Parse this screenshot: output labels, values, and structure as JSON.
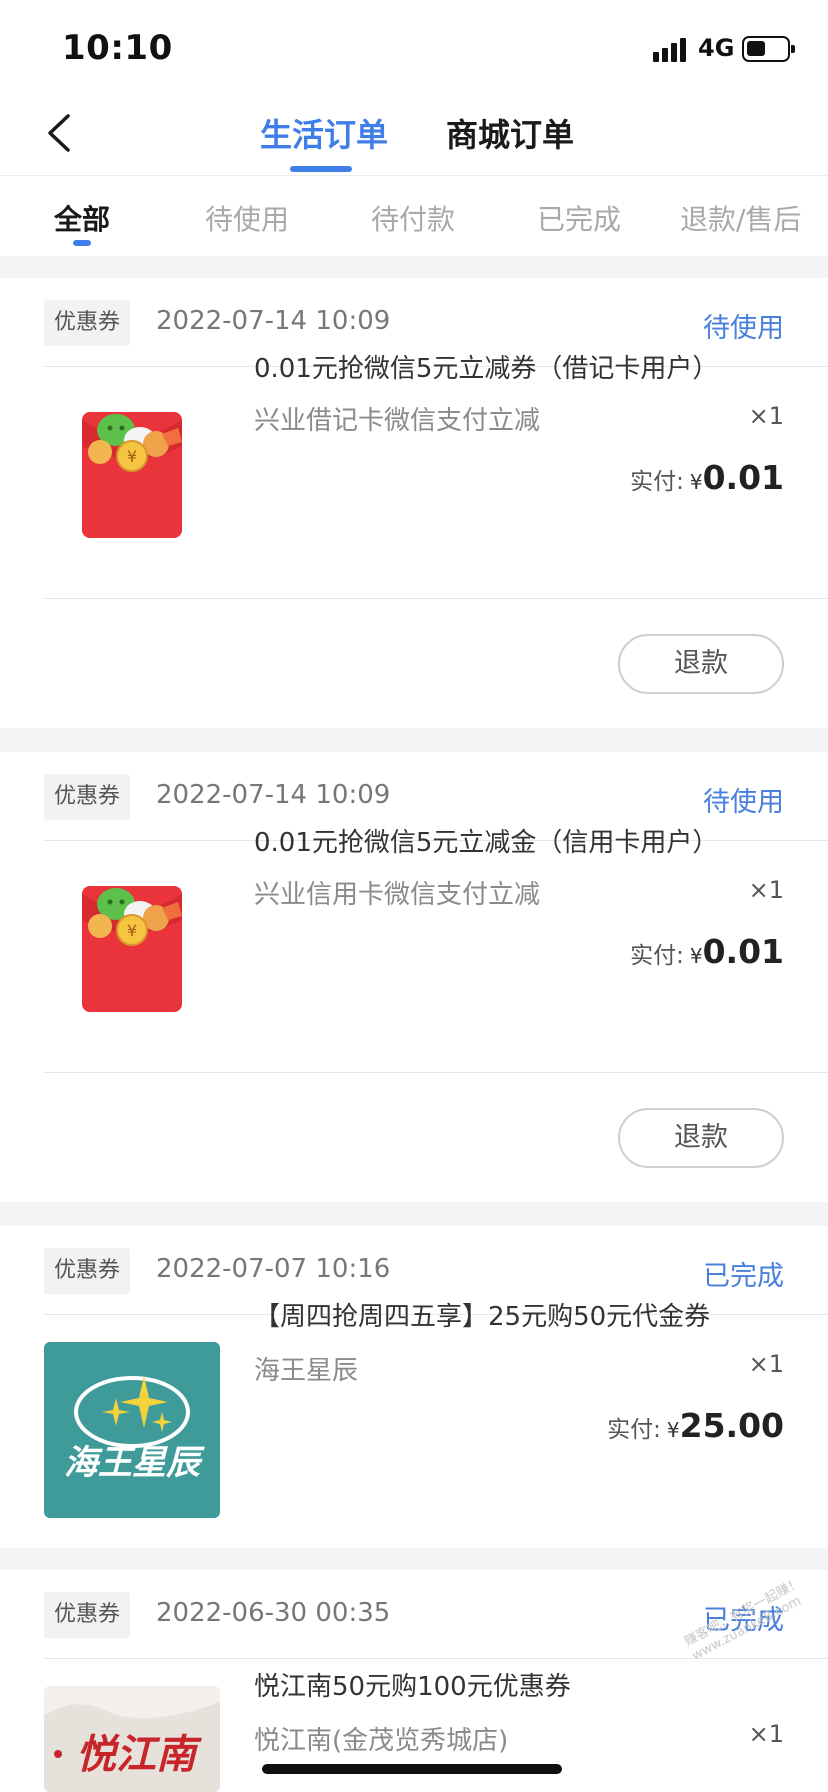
{
  "status_bar": {
    "time": "10:10",
    "network": "4G"
  },
  "header": {
    "tabs": [
      "生活订单",
      "商城订单"
    ],
    "active_tab": "生活订单"
  },
  "sub_tabs": [
    "全部",
    "待使用",
    "待付款",
    "已完成",
    "退款/售后"
  ],
  "orders": [
    {
      "tag": "优惠券",
      "time": "2022-07-14 10:09",
      "status": "待使用",
      "title": "0.01元抢微信5元立减券（借记卡用户）",
      "subtitle": "兴业借记卡微信支付立减",
      "qty": "×1",
      "paid_label": "实付:",
      "currency": "¥",
      "amount": "0.01",
      "action": "退款",
      "thumb": "wechat-red-envelope-icon"
    },
    {
      "tag": "优惠券",
      "time": "2022-07-14 10:09",
      "status": "待使用",
      "title": "0.01元抢微信5元立减金（信用卡用户）",
      "subtitle": "兴业信用卡微信支付立减",
      "qty": "×1",
      "paid_label": "实付:",
      "currency": "¥",
      "amount": "0.01",
      "action": "退款",
      "thumb": "wechat-red-envelope-icon"
    },
    {
      "tag": "优惠券",
      "time": "2022-07-07 10:16",
      "status": "已完成",
      "title": "【周四抢周四五享】25元购50元代金券",
      "subtitle": "海王星辰",
      "qty": "×1",
      "paid_label": "实付:",
      "currency": "¥",
      "amount": "25.00",
      "thumb": "haiwang-xingchen-logo",
      "logo_text": "海王星辰"
    },
    {
      "tag": "优惠券",
      "time": "2022-06-30 00:35",
      "status": "已完成",
      "title": "悦江南50元购100元优惠券",
      "subtitle": "悦江南(金茂览秀城店)",
      "qty": "×1",
      "thumb": "yuejiangnan-logo",
      "logo_text": "悦江南"
    }
  ],
  "watermark": [
    "赚客吧，有奖一起赚！",
    "www.zuanke8.com"
  ],
  "colors": {
    "accent": "#3f7ee8",
    "status": "#4a80dd",
    "background": "#f4f5f7"
  }
}
